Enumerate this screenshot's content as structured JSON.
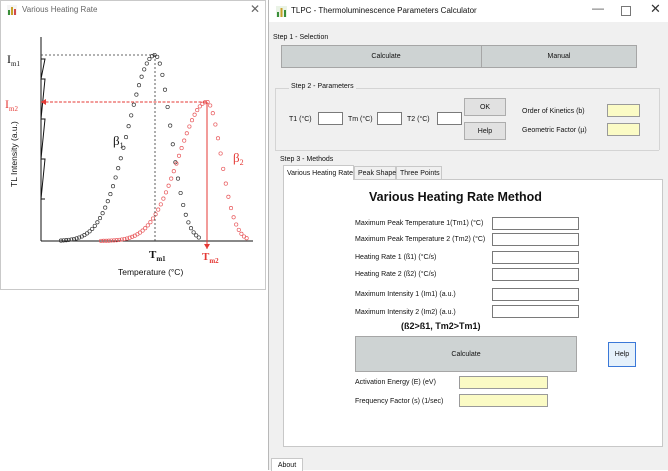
{
  "left_window": {
    "title": "Various Heating Rate",
    "plot": {
      "y_label": "TL Intensity (a.u.)",
      "x_label": "Temperature (°C)",
      "peak_1_label": "I",
      "peak_1_sub": "m1",
      "peak_2_label": "I",
      "peak_2_sub": "m2",
      "beta_1": "β",
      "beta_1_sub": "1",
      "beta_2": "β",
      "beta_2_sub": "2",
      "tm1_label": "T",
      "tm1_sub": "m1",
      "tm2_label": "T",
      "tm2_sub": "m2",
      "colors": {
        "curve_1": "#333333",
        "curve_2": "#e8585b",
        "marker_2": "#e53935"
      }
    }
  },
  "right_window": {
    "title": "TLPC - Thermoluminescence Parameters Calculator",
    "step1": {
      "label": "Step 1 - Selection",
      "calculate": "Calculate",
      "manual": "Manual"
    },
    "step2": {
      "label": "Step 2 - Parameters",
      "t1": "T1 (°C)",
      "tm": "Tm (°C)",
      "t2": "T2 (°C)",
      "t1_value": "",
      "tm_value": "",
      "t2_value": "",
      "ok": "OK",
      "help": "Help",
      "order_of_kinetics": "Order of Kinetics (b)",
      "geometric_factor": "Geometric Factor (µ)",
      "order_value": "",
      "geometric_value": ""
    },
    "step3": {
      "label": "Step 3 - Methods",
      "tabs": [
        "Various Heating Rate",
        "Peak Shape",
        "Three Points"
      ],
      "active_tab": 0,
      "method_title": "Various Heating Rate Method",
      "fields": [
        {
          "label": "Maximum Peak Temperature 1(Tm1) (°C)",
          "value": ""
        },
        {
          "label": "Maximum Peak Temperature 2 (Tm2) (°C)",
          "value": ""
        },
        {
          "label": "Heating Rate 1 (ß1) (°C/s)",
          "value": ""
        },
        {
          "label": "Heating Rate 2 (ß2) (°C/s)",
          "value": ""
        },
        {
          "label": "Maximum  Intensity 1 (Im1) (a.u.)",
          "value": ""
        },
        {
          "label": "Maximum  Intensity 2 (Im2) (a.u.)",
          "value": ""
        }
      ],
      "condition": "(ß2>ß1, Tm2>Tm1)",
      "calculate": "Calculate",
      "help": "Help",
      "results": [
        {
          "label": "Activation Energy (E) (eV)",
          "value": ""
        },
        {
          "label": "Frequency Factor (s) (1/sec)",
          "value": ""
        }
      ]
    },
    "about_tab": "About",
    "colors": {
      "output_fill": "#fbfbc5",
      "button_gray": "#ced3d3"
    }
  }
}
